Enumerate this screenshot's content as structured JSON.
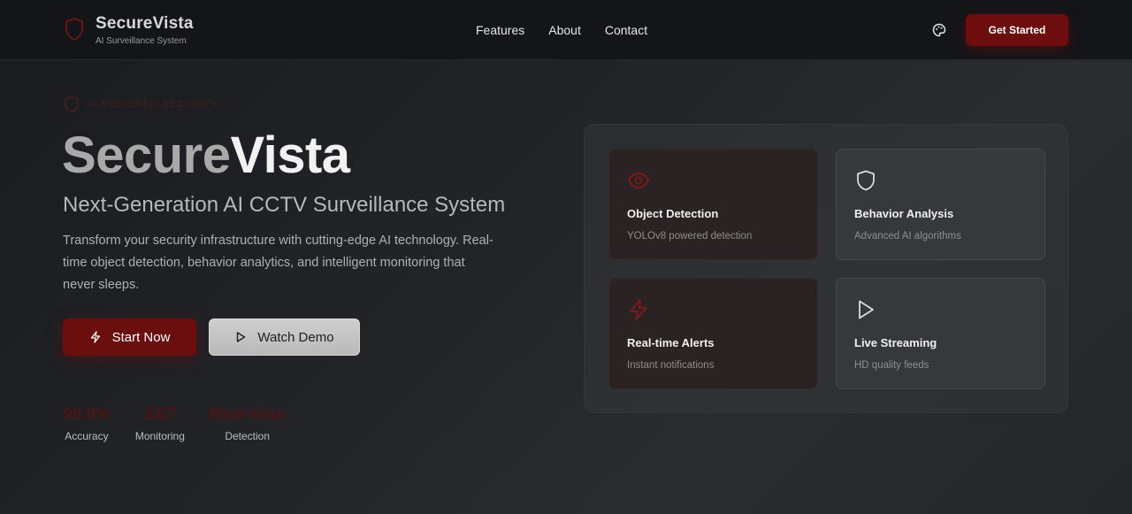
{
  "brand": {
    "name": "SecureVista",
    "subtitle": "AI Surveillance System"
  },
  "nav": {
    "links": [
      "Features",
      "About",
      "Contact"
    ],
    "cta_label": "Get Started"
  },
  "hero": {
    "badge": "AI-POWERED SECURITY",
    "title_part1": "Secure",
    "title_part2": "Vista",
    "subtitle": "Next-Generation AI CCTV Surveillance System",
    "description": "Transform your security infrastructure with cutting-edge AI technology. Real-time object detection, behavior analytics, and intelligent monitoring that never sleeps.",
    "primary_button": "Start Now",
    "secondary_button": "Watch Demo"
  },
  "stats": [
    {
      "value": "99.9%",
      "label": "Accuracy"
    },
    {
      "value": "24/7",
      "label": "Monitoring"
    },
    {
      "value": "Real-time",
      "label": "Detection"
    }
  ],
  "features": [
    {
      "title": "Object Detection",
      "desc": "YOLOv8 powered detection",
      "icon": "eye-icon"
    },
    {
      "title": "Behavior Analysis",
      "desc": "Advanced AI algorithms",
      "icon": "shield-icon"
    },
    {
      "title": "Real-time Alerts",
      "desc": "Instant notifications",
      "icon": "lightning-icon"
    },
    {
      "title": "Live Streaming",
      "desc": "HD quality feeds",
      "icon": "play-icon"
    }
  ],
  "colors": {
    "accent": "#6d0d0d",
    "accent_icon": "#7a1a1a",
    "background": "#1e1f22"
  }
}
